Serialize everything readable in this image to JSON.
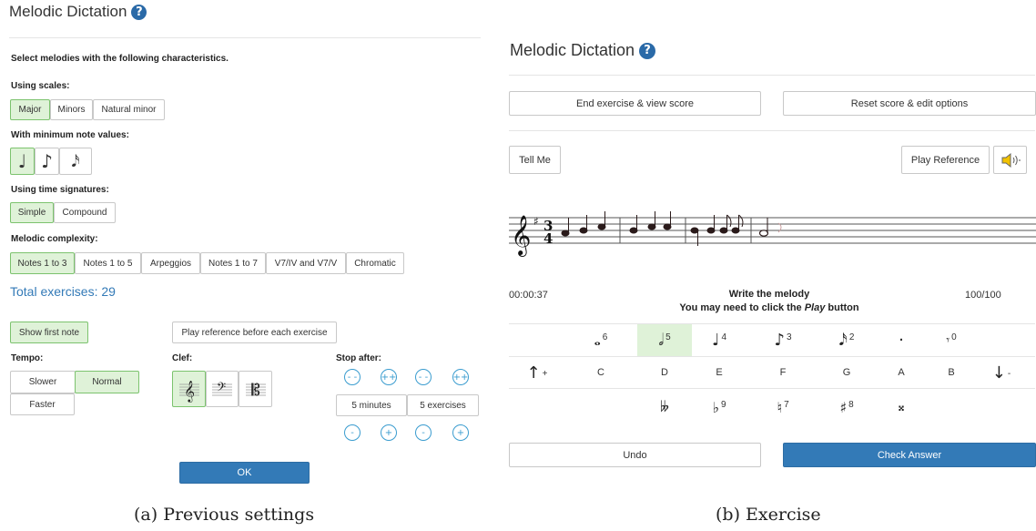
{
  "left": {
    "title": "Melodic Dictation",
    "help_glyph": "?",
    "intro": "Select melodies with the following characteristics.",
    "scales": {
      "label": "Using scales:",
      "options": [
        "Major",
        "Minors",
        "Natural minor"
      ],
      "selected": "Major"
    },
    "note_values": {
      "label": "With minimum note values:",
      "options": [
        "quarter-note-icon",
        "eighth-note-icon",
        "sixteenth-note-icon"
      ],
      "selected": "quarter-note-icon"
    },
    "time_signatures": {
      "label": "Using time signatures:",
      "options": [
        "Simple",
        "Compound"
      ],
      "selected": "Simple"
    },
    "complexity": {
      "label": "Melodic complexity:",
      "options": [
        "Notes 1 to 3",
        "Notes 1 to 5",
        "Arpeggios",
        "Notes 1 to 7",
        "V7/IV and V7/V",
        "Chromatic"
      ],
      "selected": "Notes 1 to 3"
    },
    "total_exercises": "Total exercises: 29",
    "show_first_note": "Show first note",
    "play_reference_each": "Play reference before each exercise",
    "tempo": {
      "label": "Tempo:",
      "slower": "Slower",
      "normal": "Normal",
      "faster": "Faster",
      "selected": "Normal"
    },
    "clef": {
      "label": "Clef:",
      "options": [
        "treble-clef-icon",
        "bass-clef-icon",
        "alto-clef-icon"
      ],
      "selected": "treble-clef-icon"
    },
    "stop_after": {
      "label": "Stop after:",
      "minutes": "5 minutes",
      "exercises": "5 exercises",
      "dec_big": "- -",
      "inc_big": "++",
      "dec": "-",
      "inc": "+"
    },
    "ok": "OK",
    "caption": "(a) Previous settings"
  },
  "right": {
    "title": "Melodic Dictation",
    "help_glyph": "?",
    "end_exercise": "End exercise & view score",
    "reset_score": "Reset score & edit options",
    "tell_me": "Tell Me",
    "play_reference": "Play Reference",
    "speaker_icon": "speaker-icon",
    "timer": "00:00:37",
    "instruction_1": "Write the melody",
    "instruction_2_pre": "You may need to click the ",
    "instruction_2_em": "Play",
    "instruction_2_post": " button",
    "score": "100/100",
    "durations": [
      {
        "icon": "whole-note-icon",
        "glyph": "𝅝",
        "key": "6",
        "selected": false
      },
      {
        "icon": "half-note-icon",
        "glyph": "𝅗𝅥",
        "key": "5",
        "selected": true
      },
      {
        "icon": "quarter-note-icon",
        "glyph": "♩",
        "key": "4",
        "selected": false
      },
      {
        "icon": "eighth-note-icon",
        "glyph": "♪",
        "key": "3",
        "selected": false
      },
      {
        "icon": "sixteenth-note-icon",
        "glyph": "𝅘𝅥𝅯",
        "key": "2",
        "selected": false
      },
      {
        "icon": "dot-icon",
        "glyph": "·",
        "key": "",
        "selected": false
      },
      {
        "icon": "rest-icon",
        "glyph": "𝄾",
        "key": "0",
        "selected": false
      }
    ],
    "octave_up": {
      "glyph": "↑",
      "key": "+"
    },
    "octave_down": {
      "glyph": "↓",
      "key": "-"
    },
    "pitches": [
      "C",
      "D",
      "E",
      "F",
      "G",
      "A",
      "B"
    ],
    "accidentals": [
      {
        "icon": "double-flat-icon",
        "glyph": "𝄫",
        "key": ""
      },
      {
        "icon": "flat-icon",
        "glyph": "♭",
        "key": "9"
      },
      {
        "icon": "natural-icon",
        "glyph": "♮",
        "key": "7"
      },
      {
        "icon": "sharp-icon",
        "glyph": "♯",
        "key": "8"
      },
      {
        "icon": "double-sharp-icon",
        "glyph": "𝄪",
        "key": ""
      }
    ],
    "undo": "Undo",
    "check_answer": "Check Answer",
    "caption": "(b) Exercise"
  }
}
